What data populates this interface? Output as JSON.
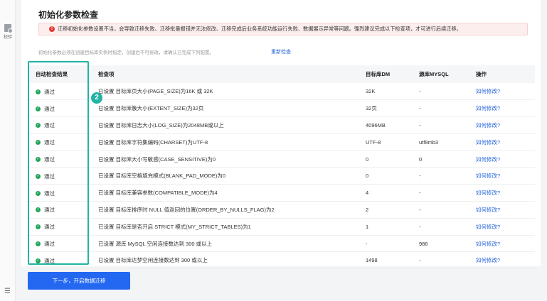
{
  "sidebar": {
    "verify_label": "校验",
    "collapse_icon": "☰"
  },
  "page": {
    "title": "初始化参数检查"
  },
  "warning": {
    "icon": "!",
    "text": "迁移初始化参数设置不当，会导致迁移失败、迁移批量报错并无法修改、迁移完成后业务系统功能运行失败、数据展示异常等问题。强烈建议完成以下检查项，才可进行后续迁移。"
  },
  "hint": {
    "text": "初始化参数必须在创建目标库实例时指定，创建后不可修改，请确认已完成下列配置。",
    "recheck_label": "重新检查"
  },
  "table": {
    "headers": {
      "result": "自动检查结果",
      "item": "检查项",
      "target": "目标库DM",
      "source": "源库MYSQL",
      "action": "操作"
    },
    "rows": [
      {
        "status": "通过",
        "item": "已设置 目标库页大小(PAGE_SIZE)为16K 或 32K",
        "target": "32K",
        "source": "-",
        "action": "如何修改?"
      },
      {
        "status": "通过",
        "item": "已设置 目标库簇大小(EXTENT_SIZE)为32页",
        "target": "32页",
        "source": "-",
        "action": "如何修改?"
      },
      {
        "status": "通过",
        "item": "已设置 目标库日志大小(LOG_SIZE)为2048MB或以上",
        "target": "4096MB",
        "source": "-",
        "action": "如何修改?"
      },
      {
        "status": "通过",
        "item": "已设置 目标库字符集编码(CHARSET)为UTF-8",
        "target": "UTF-8",
        "source": "utf8mb3",
        "action": "如何修改?"
      },
      {
        "status": "通过",
        "item": "已设置 目标库大小写敏感(CASE_SENSITIVE)为0",
        "target": "0",
        "source": "0",
        "action": "如何修改?"
      },
      {
        "status": "通过",
        "item": "已设置 目标库空格填充模式(BLANK_PAD_MODE)为0",
        "target": "0",
        "source": "-",
        "action": "如何修改?"
      },
      {
        "status": "通过",
        "item": "已设置 目标库兼容参数(COMPATIBLE_MODE)为4",
        "target": "4",
        "source": "-",
        "action": "如何修改?"
      },
      {
        "status": "通过",
        "item": "已设置 目标库排序时 NULL 值返回的位置(ORDER_BY_NULLS_FLAG)为2",
        "target": "2",
        "source": "-",
        "action": "如何修改?"
      },
      {
        "status": "通过",
        "item": "已设置 目标库是否开启 STRICT 模式(MY_STRICT_TABLES)为1",
        "target": "1",
        "source": "-",
        "action": "如何修改?"
      },
      {
        "status": "通过",
        "item": "已设置 源库 MySQL 空闲连接数达到 300 或以上",
        "target": "-",
        "source": "986",
        "action": "如何修改?"
      },
      {
        "status": "通过",
        "item": "已设置 目标库达梦空闲连接数达到 300 或以上",
        "target": "1498",
        "source": "-",
        "action": "如何修改?"
      }
    ]
  },
  "annotation": {
    "marker": "2",
    "color": "#21b3a3"
  },
  "footer": {
    "next_label": "下一步，开启数据迁移"
  },
  "colors": {
    "accent": "#2468f2",
    "link": "#2464d8",
    "success": "#23a55a",
    "warning": "#e53935"
  }
}
